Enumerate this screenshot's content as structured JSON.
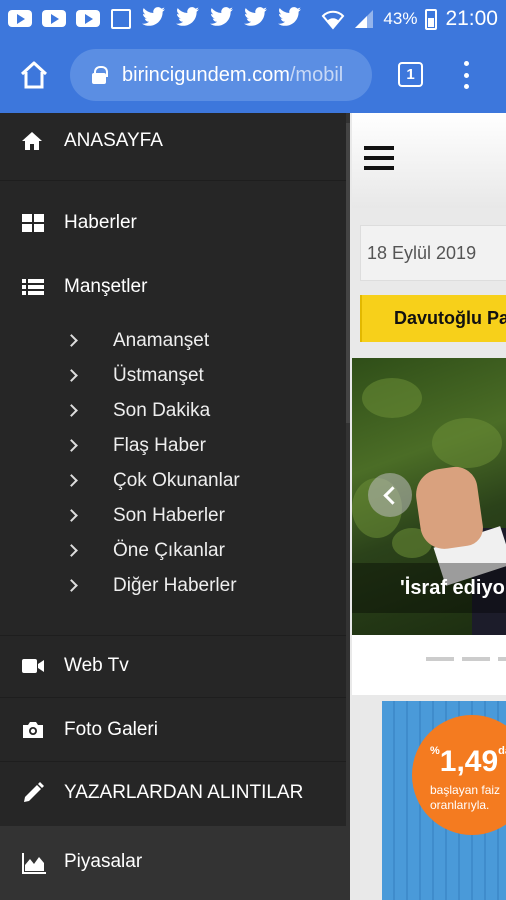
{
  "status_bar": {
    "battery": "43%",
    "time": "21:00"
  },
  "browser": {
    "url_domain": "birincigundem.com",
    "url_path": "/mobil",
    "tab_count": "1"
  },
  "sidebar": {
    "home": "ANASAYFA",
    "haberler": "Haberler",
    "mansetler": "Manşetler",
    "sub_items": [
      "Anamanşet",
      "Üstmanşet",
      "Son Dakika",
      "Flaş Haber",
      "Çok Okunanlar",
      "Son Haberler",
      "Öne Çıkanlar",
      "Diğer Haberler"
    ],
    "web_tv": "Web Tv",
    "foto_galeri": "Foto Galeri",
    "yazarlar": "YAZARLARDAN ALINTILAR",
    "piyasalar": "Piyasalar"
  },
  "content": {
    "date": "18 Eylül 2019",
    "headline": "Davutoğlu Pa",
    "slide_caption": "'İsraf ediyo",
    "ad": {
      "rate": "1,49",
      "rate_prefix": "%",
      "rate_suffix": "dan",
      "line1": "başlayan faiz",
      "line2": "oranlarıyla."
    }
  },
  "colors": {
    "browser_blue": "#3d77dc",
    "sidebar_bg": "#262626",
    "headline_yellow": "#f7d01a",
    "ad_orange": "#f47b20"
  }
}
